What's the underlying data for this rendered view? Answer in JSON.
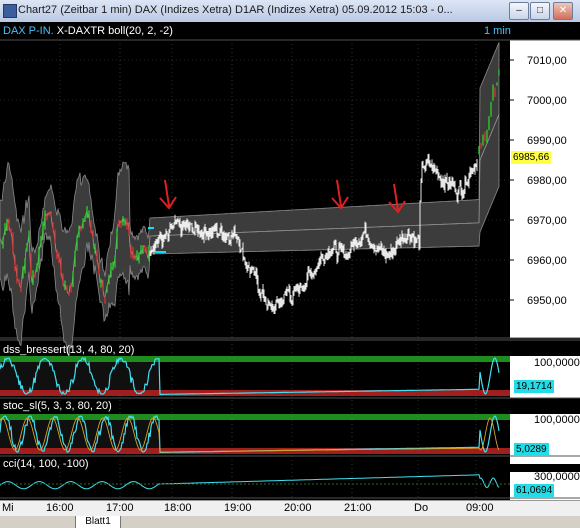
{
  "window": {
    "title": "Chart27 (Zeitbar 1 min)  DAX (Indizes Xetra) D1AR (Indizes Xetra) 05.09.2012 15:03 - 0...",
    "min_symbol": "–",
    "max_symbol": "□",
    "close_symbol": "✕"
  },
  "main_pane": {
    "instrument_label": "DAX P-IN.",
    "indicator_label": "X-DAXTR boll(20, 2, -2)",
    "interval_label": "1 min",
    "y_ticks": [
      "7010,00",
      "7000,00",
      "6990,00",
      "6980,00",
      "6970,00",
      "6960,00",
      "6950,00"
    ],
    "last_price": "6985,66",
    "ylim": [
      6941,
      7015
    ]
  },
  "panes": [
    {
      "label": "dss_bressert(13, 4, 80, 20)",
      "top_value": "100,0000",
      "current_value": "19,1714",
      "badge_color": "#22dde8"
    },
    {
      "label": "stoc_sl(5, 3, 3, 80, 20)",
      "top_value": "100,0000",
      "current_value": "5,0289",
      "badge_color": "#22dde8"
    },
    {
      "label": "cci(14, 100, -100)",
      "top_value": "300,0000",
      "current_value": "61,0694",
      "badge_color": "#22dde8"
    }
  ],
  "time_axis": {
    "labels": [
      "Mi",
      "16:00",
      "17:00",
      "18:00",
      "19:00",
      "20:00",
      "21:00",
      "Do",
      "09:00"
    ]
  },
  "sheet_tab": "Blatt1",
  "colors": {
    "background": "#000000",
    "band": "#3c3c3c",
    "up": "#2bd02b",
    "down": "#e03030",
    "price": "#ffffff",
    "arrow": "#e02020",
    "osc": "#40e0f0",
    "overbought": "#1e8c1e",
    "oversold": "#a01e1e",
    "level_marker": "#00e5ff"
  }
}
